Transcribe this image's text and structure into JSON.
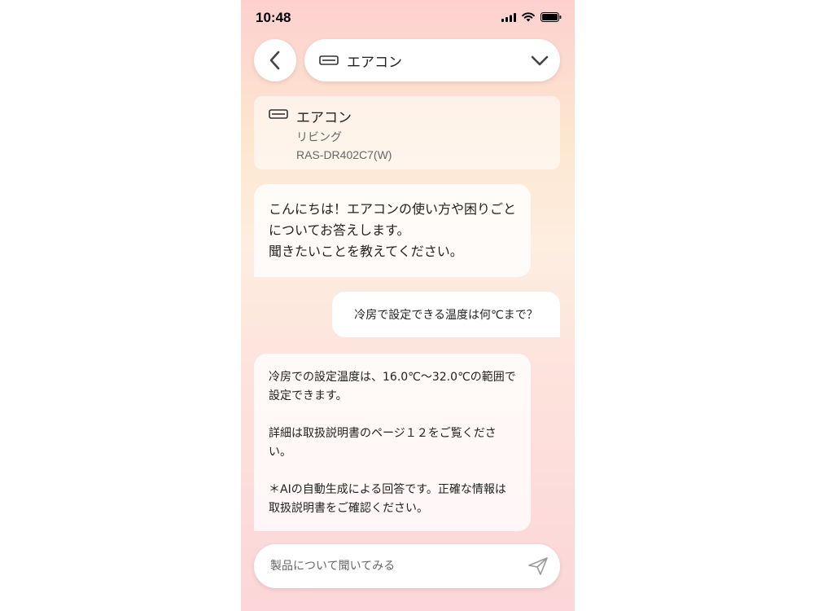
{
  "status_bar": {
    "time": "10:48"
  },
  "header": {
    "back_icon": "chevron-left-icon",
    "device_selector_label": "エアコン",
    "device_icon": "air-conditioner-icon",
    "dropdown_icon": "chevron-down-icon"
  },
  "device_card": {
    "name": "エアコン",
    "room": "リビング",
    "model": "RAS-DR402C7(W)"
  },
  "messages": [
    {
      "role": "assistant",
      "lines": [
        "こんにちは！エアコンの使い方や困りごとについてお答えします。",
        "聞きたいことを教えてください。"
      ]
    },
    {
      "role": "user",
      "text": "冷房で設定できる温度は何℃まで？"
    },
    {
      "role": "assistant",
      "paragraphs": [
        "冷房での設定温度は、16.0℃〜32.0℃の範囲で設定できます。",
        "詳細は取扱説明書のページ１２をご覧ください。",
        "＊AIの自動生成による回答です。正確な情報は取扱説明書をご確認ください。"
      ]
    }
  ],
  "input": {
    "placeholder": "製品について聞いてみる",
    "send_icon": "send-icon"
  },
  "colors": {
    "background_top": "#fdd0cf",
    "background_mid": "#fdeee0",
    "bubble": "#ffffff"
  }
}
